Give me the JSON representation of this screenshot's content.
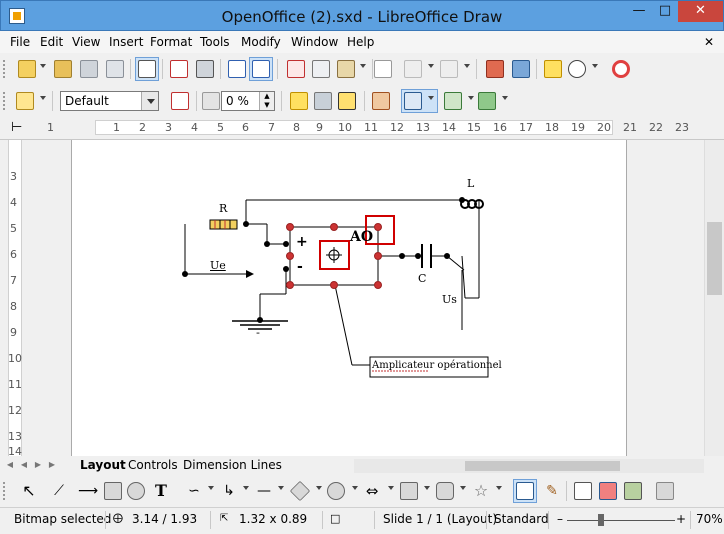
{
  "window": {
    "title": "OpenOffice (2).sxd - LibreOffice Draw"
  },
  "menu": [
    "File",
    "Edit",
    "View",
    "Insert",
    "Format",
    "Tools",
    "Modify",
    "Window",
    "Help"
  ],
  "toolbar2": {
    "style_value": "Default",
    "transparency_value": "0 %"
  },
  "rulers": {
    "horizontal": [
      "1",
      "1",
      "2",
      "3",
      "4",
      "5",
      "6",
      "7",
      "8",
      "9",
      "10",
      "11",
      "12",
      "13",
      "14",
      "15",
      "16",
      "17",
      "18",
      "19",
      "20",
      "21",
      "22",
      "23"
    ],
    "vertical": [
      "3",
      "4",
      "5",
      "6",
      "7",
      "8",
      "9",
      "10",
      "11",
      "12",
      "13",
      "14"
    ]
  },
  "diagram": {
    "label_R": "R",
    "label_L": "L",
    "label_AO": "AO",
    "label_plus": "+",
    "label_minus": "-",
    "label_C": "C",
    "label_Ue": "Ue",
    "label_Us": "Us",
    "label_ground": "-",
    "callout_word1": "Amplicateur",
    "callout_word2": "opérationnel"
  },
  "tabs": [
    "Layout",
    "Controls",
    "Dimension Lines"
  ],
  "status": {
    "selection": "Bitmap selected",
    "position": "3.14 / 1.93",
    "size": "1.32 x 0.89",
    "slide": "Slide 1 / 1 (Layout)",
    "master": "Standard",
    "zoom": "70%"
  },
  "colors": {
    "titlebar": "#5ca0e0",
    "selection_handle": "#cc3333",
    "selection_box": "#d00000",
    "active_tool": "#cde2f7"
  }
}
